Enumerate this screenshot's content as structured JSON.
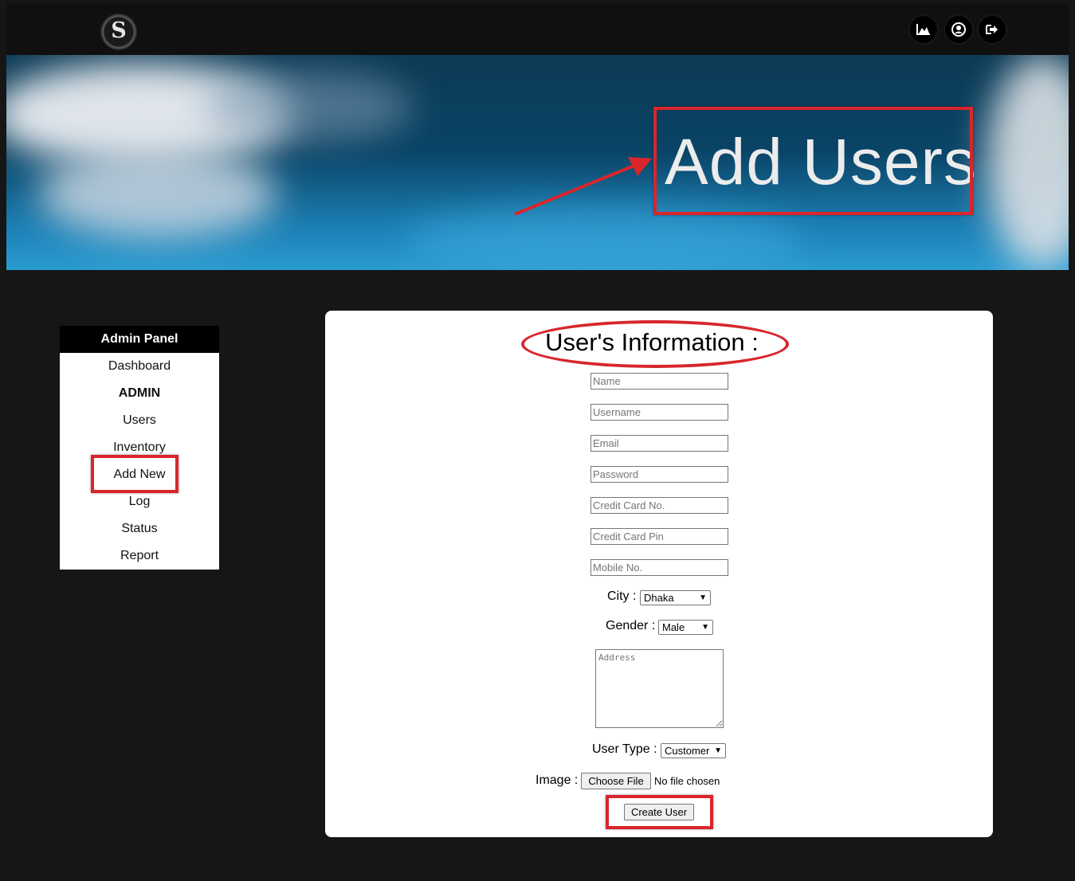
{
  "topbar": {
    "logo_letter": "S",
    "icons": [
      "chart-icon",
      "user-account-icon",
      "logout-icon"
    ]
  },
  "banner": {
    "title": "Add Users"
  },
  "sidebar": {
    "heading": "Admin Panel",
    "items": [
      {
        "label": "Dashboard"
      },
      {
        "label": "ADMIN"
      },
      {
        "label": "Users"
      },
      {
        "label": "Inventory"
      },
      {
        "label": "Add New"
      },
      {
        "label": "Log"
      },
      {
        "label": "Status"
      },
      {
        "label": "Report"
      }
    ]
  },
  "form": {
    "title": "User's Information :",
    "placeholders": {
      "name": "Name",
      "username": "Username",
      "email": "Email",
      "password": "Password",
      "cc_no": "Credit Card No.",
      "cc_pin": "Credit Card Pin",
      "mobile": "Mobile No.",
      "address": "Address"
    },
    "city_label": "City :",
    "city_value": "Dhaka",
    "gender_label": "Gender :",
    "gender_value": "Male",
    "user_type_label": "User Type :",
    "user_type_value": "Customer",
    "image_label": "Image :",
    "choose_file_label": "Choose File",
    "no_file_text": "No file chosen",
    "submit_label": "Create User"
  },
  "colors": {
    "highlight": "#d8262c",
    "background": "#161616",
    "topbar": "#101010"
  }
}
